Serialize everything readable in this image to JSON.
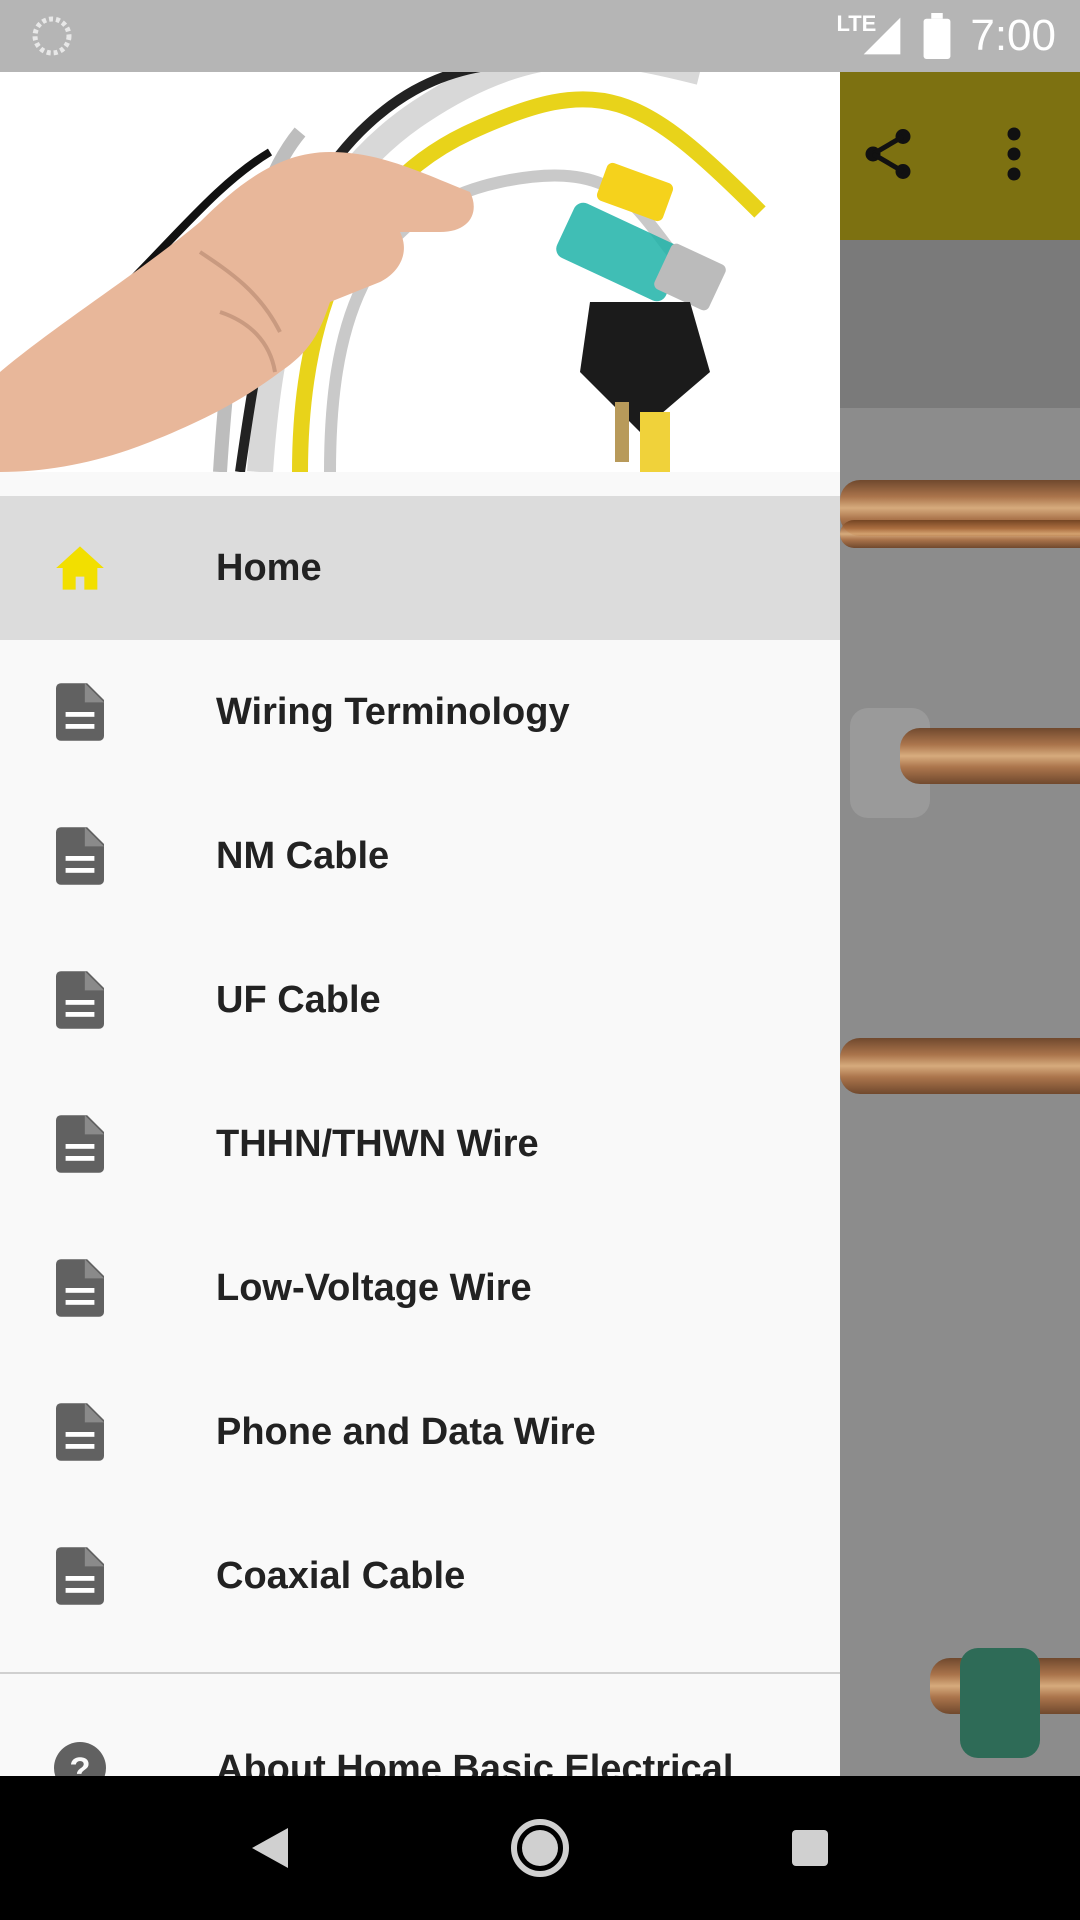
{
  "status_bar": {
    "network": "LTE",
    "time": "7:00"
  },
  "toolbar": {
    "share_icon": "share-icon",
    "overflow_icon": "more-vert-icon",
    "color": "#7d7111"
  },
  "drawer": {
    "header_image": "hand holding assorted cables and plugs",
    "items": [
      {
        "label": "Home",
        "icon": "home-icon",
        "active": true
      },
      {
        "label": "Wiring Terminology",
        "icon": "document-icon"
      },
      {
        "label": "NM Cable",
        "icon": "document-icon"
      },
      {
        "label": "UF Cable",
        "icon": "document-icon"
      },
      {
        "label": "THHN/THWN Wire",
        "icon": "document-icon"
      },
      {
        "label": "Low-Voltage Wire",
        "icon": "document-icon"
      },
      {
        "label": "Phone and Data Wire",
        "icon": "document-icon"
      },
      {
        "label": "Coaxial Cable",
        "icon": "document-icon"
      }
    ],
    "about": {
      "label": "About Home Basic Electrical",
      "icon": "help-icon"
    },
    "accent_color": "#f2df00",
    "active_bg": "#dcdcdc"
  },
  "system_nav": {
    "back": "back-icon",
    "home": "home-circle-icon",
    "recents": "recents-icon"
  }
}
